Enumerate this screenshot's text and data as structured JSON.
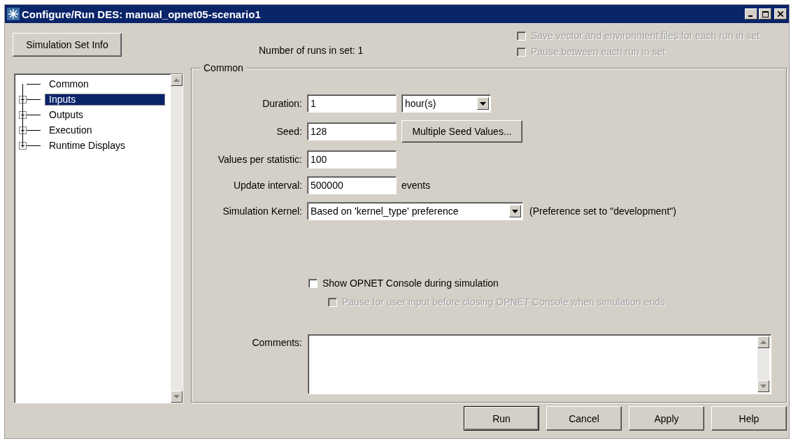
{
  "window": {
    "title": "Configure/Run DES: manual_opnet05-scenario1"
  },
  "simulation_set_button": "Simulation Set Info",
  "runs_in_set": "Number of runs in set:  1",
  "set_options": [
    {
      "label": "Save vector and environment files for each run in set",
      "checked": false,
      "disabled": true
    },
    {
      "label": "Pause between each run in set",
      "checked": false,
      "disabled": true
    }
  ],
  "tree": [
    {
      "kind": "leaf",
      "label": "Common",
      "selected": false
    },
    {
      "kind": "branch",
      "label": "Inputs",
      "selected": true
    },
    {
      "kind": "branch",
      "label": "Outputs",
      "selected": false
    },
    {
      "kind": "branch",
      "label": "Execution",
      "selected": false
    },
    {
      "kind": "branch",
      "label": "Runtime Displays",
      "selected": false
    }
  ],
  "group": {
    "title": "Common",
    "fields": [
      {
        "kind": "combo",
        "label": "Duration:",
        "value": "1",
        "option": "hour(s)"
      },
      {
        "kind": "button",
        "label": "Seed:",
        "value": "128",
        "button": "Multiple Seed Values..."
      },
      {
        "kind": "text",
        "label": "Values per statistic:",
        "value": "100"
      },
      {
        "kind": "unit",
        "label": "Update interval:",
        "value": "500000",
        "unit": "events"
      },
      {
        "kind": "select",
        "label": "Simulation Kernel:",
        "value": "Based on 'kernel_type' preference",
        "note": "(Preference set to \"development\")"
      }
    ],
    "console_options": [
      {
        "label": "Show OPNET Console during simulation",
        "checked": false,
        "disabled": false
      },
      {
        "label": "Pause for user input before closing OPNET Console when simulation ends",
        "checked": false,
        "disabled": true
      }
    ],
    "comments_label": "Comments:"
  },
  "buttons": [
    "Run",
    "Cancel",
    "Apply",
    "Help"
  ]
}
